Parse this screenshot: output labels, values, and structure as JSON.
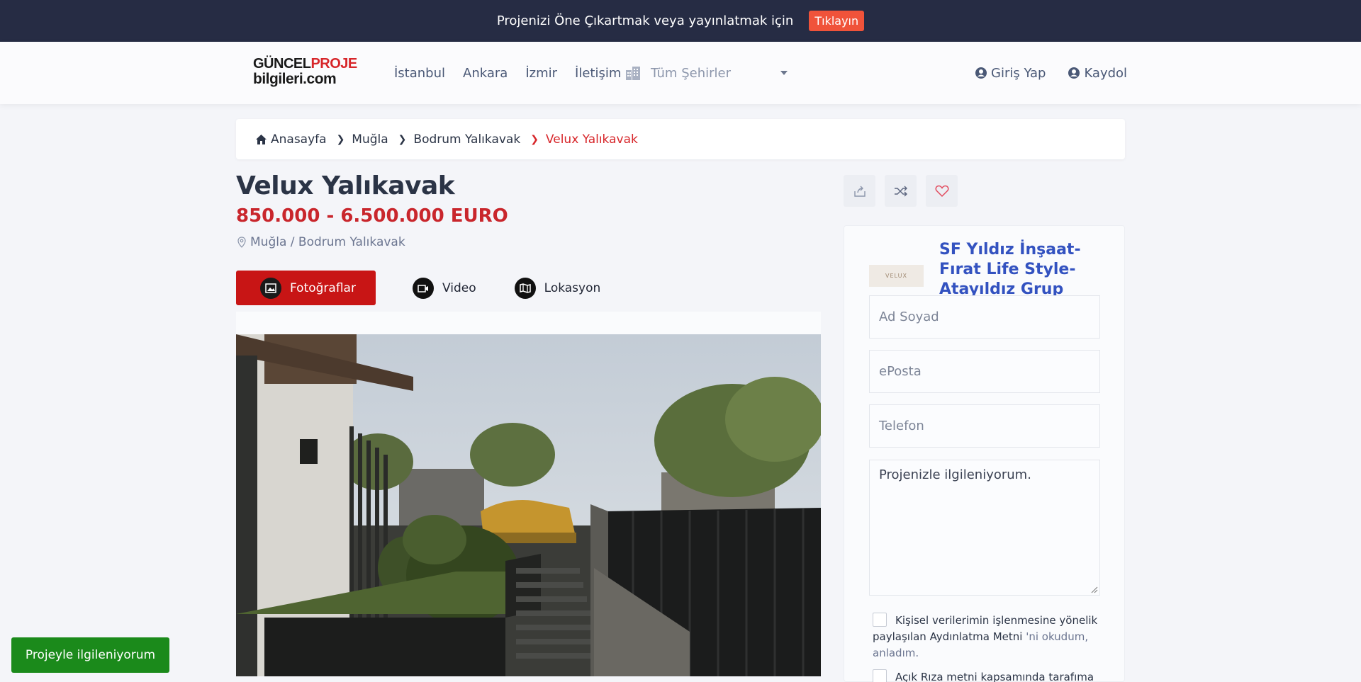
{
  "topbar": {
    "text": "Projenizi Öne Çıkartmak veya yayınlatmak için",
    "button": "Tıklayın"
  },
  "logo": {
    "line1_dark": "GÜNCEL",
    "line1_red": "PROJE",
    "line2": "bilgileri.com"
  },
  "nav": {
    "links": [
      "İstanbul",
      "Ankara",
      "İzmir",
      "İletişim"
    ],
    "city_select": "Tüm Şehirler",
    "login": "Giriş Yap",
    "register": "Kaydol"
  },
  "breadcrumb": [
    "Anasayfa",
    "Muğla",
    "Bodrum Yalıkavak",
    "Velux Yalıkavak"
  ],
  "project": {
    "title": "Velux Yalıkavak",
    "price": "850.000 - 6.500.000 EURO",
    "location": "Muğla / Bodrum Yalıkavak"
  },
  "tabs": [
    "Fotoğraflar",
    "Video",
    "Lokasyon"
  ],
  "agency": {
    "name": "SF Yıldız İnşaat-Fırat Life Style-Atayıldız Grup",
    "logo_text": "VELUX"
  },
  "form": {
    "name_placeholder": "Ad Soyad",
    "email_placeholder": "ePosta",
    "phone_placeholder": "Telefon",
    "message": "Projenizle ilgileniyorum.",
    "consent1_a": "Kişisel verilerimin işlenmesine yönelik paylaşılan Aydınlatma Metni",
    "consent1_b": "'ni okudum, anladım.",
    "consent2": "Açık Rıza metni kapsamında tarafıma"
  },
  "cta": "Projeyle ilgileniyorum",
  "colors": {
    "accent_red": "#c81515",
    "topbar_bg": "#262c44",
    "agency_blue": "#3352c0",
    "cta_green": "#1b8a1b"
  }
}
